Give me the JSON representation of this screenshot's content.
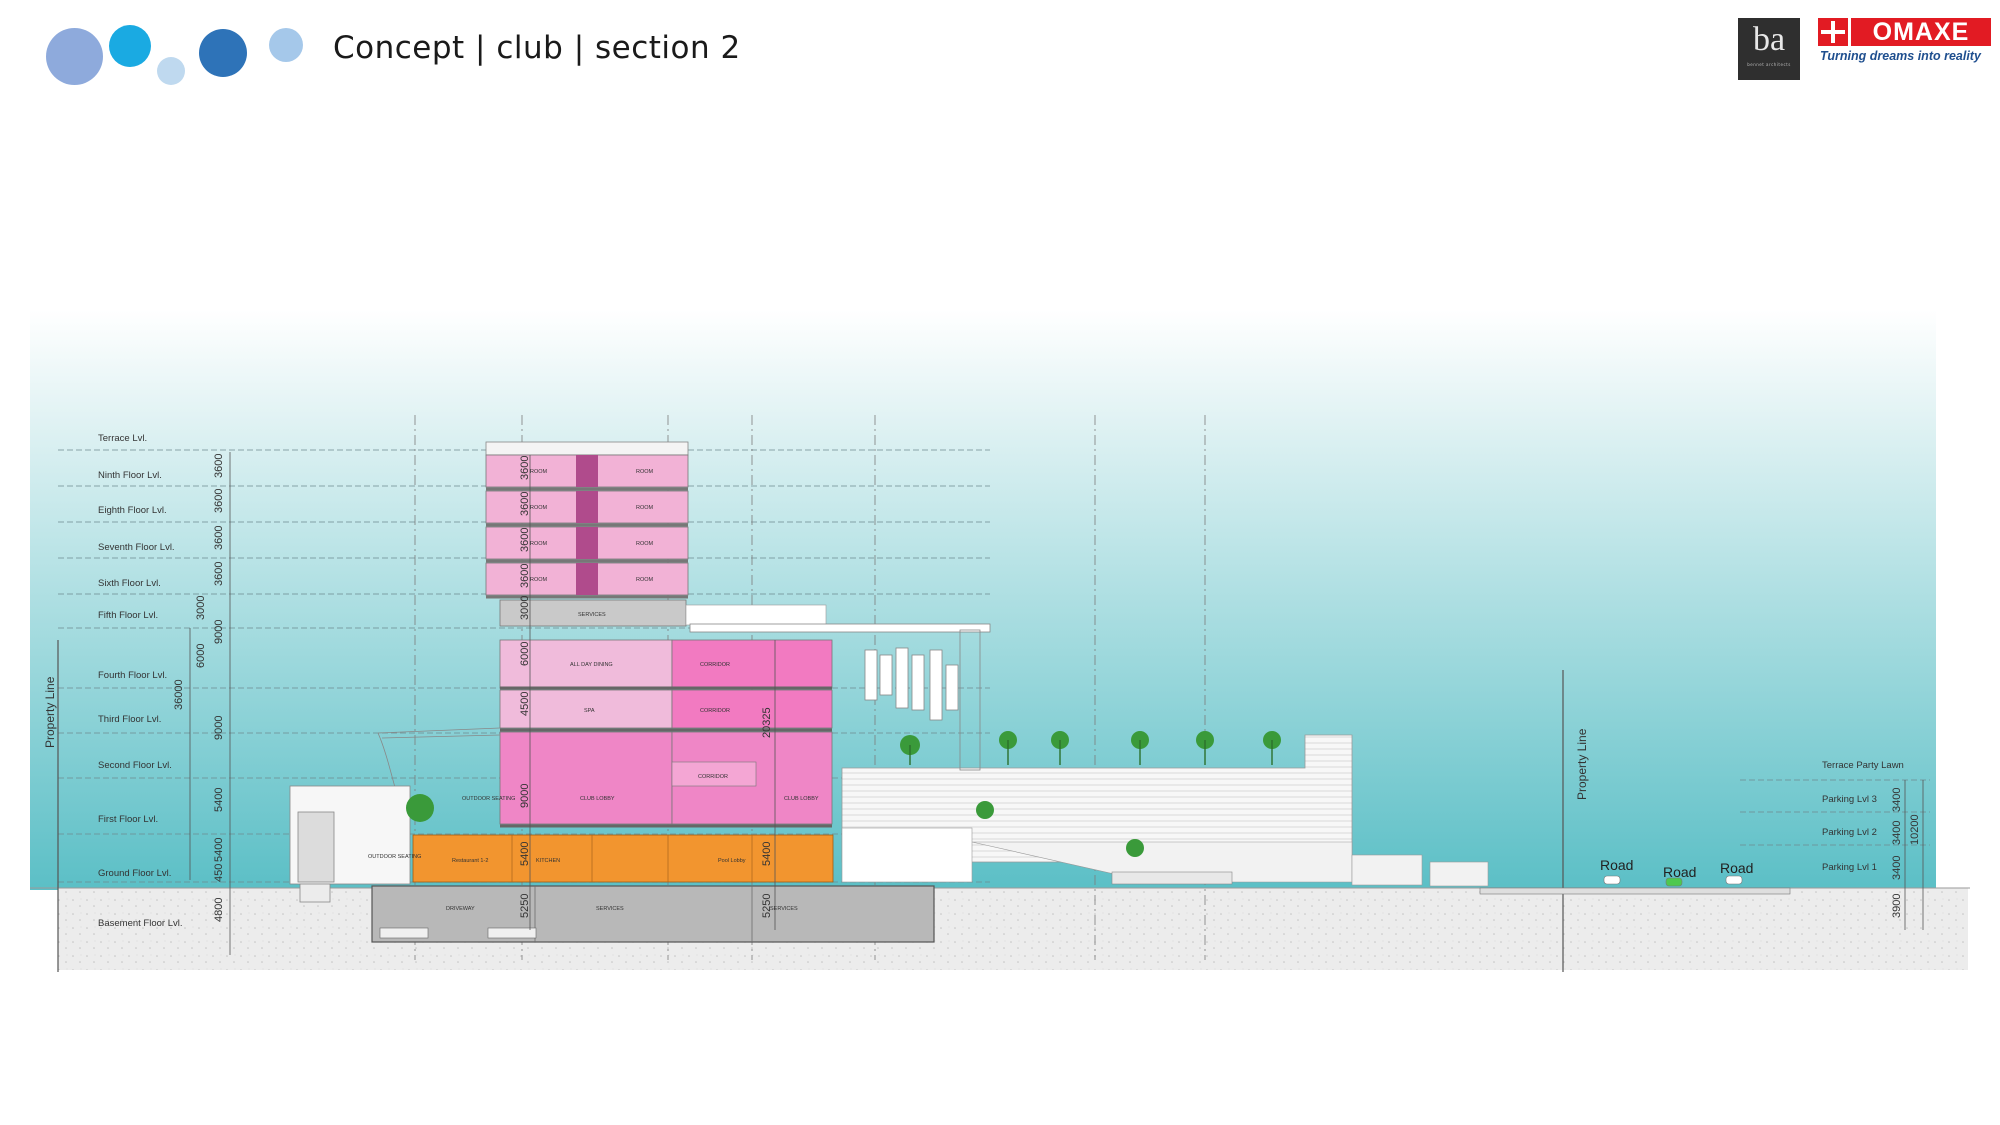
{
  "header": {
    "title": "Concept | club | section 2",
    "dot_colors": [
      "#8eaadc",
      "#1aaae2",
      "#bfd9ef",
      "#2e73b8",
      "#a5c8ea"
    ]
  },
  "logos": {
    "ba": {
      "mark": "ba",
      "subtitle": "bennet architects"
    },
    "omaxe": {
      "name": "OMAXE",
      "tagline": "Turning dreams into reality",
      "color": "#e21b23"
    }
  },
  "section": {
    "property_line_label": "Property Line",
    "levels": [
      "Terrace Lvl.",
      "Ninth Floor Lvl.",
      "Eighth Floor Lvl.",
      "Seventh Floor Lvl.",
      "Sixth Floor Lvl.",
      "Fifth Floor Lvl.",
      "Fourth Floor Lvl.",
      "Third Floor Lvl.",
      "Second Floor Lvl.",
      "First Floor Lvl.",
      "Ground Floor Lvl.",
      "Basement Floor Lvl."
    ],
    "left_dims": [
      "3600",
      "3600",
      "3600",
      "3600",
      "3000",
      "6000",
      "36000",
      "9000",
      "9000",
      "5400",
      "5400",
      "450",
      "4800"
    ],
    "inner_dims": [
      "3600",
      "3600",
      "3600",
      "3600",
      "3000",
      "6000",
      "4500",
      "9000",
      "5400",
      "5250",
      "20325",
      "5400",
      "5250"
    ],
    "room_labels": {
      "room": "ROOM",
      "services": "SERVICES",
      "all_day_dining": "ALL DAY DINING",
      "corridor": "CORRIDOR",
      "spa": "SPA",
      "club_lobby": "CLUB LOBBY",
      "restaurant": "Restaurant 1-2",
      "kitchen": "KITCHEN",
      "pool_lobby": "Pool Lobby",
      "driveway": "DRIVEWAY",
      "outdoor_seating": "OUTDOOR SEATING",
      "outdoor_seating_2": "OUTDOOR SEATING"
    },
    "right_levels": [
      "Terrace Party Lawn",
      "Parking Lvl 3",
      "Parking Lvl 2",
      "Parking Lvl 1"
    ],
    "right_dims": [
      "3400",
      "3400",
      "3400",
      "10200",
      "3900"
    ],
    "road_labels": [
      "Road",
      "Road",
      "Road"
    ],
    "colors": {
      "sky_top": "#ffffff",
      "sky_bottom": "#5bbfc6",
      "room_pink": "#f2b2d6",
      "club_pink": "#ef86c6",
      "corridor_pink": "#f27ac1",
      "service_grey": "#c9c9c9",
      "ground_orange": "#f2952f",
      "basement_grey": "#b8b8b8"
    }
  }
}
